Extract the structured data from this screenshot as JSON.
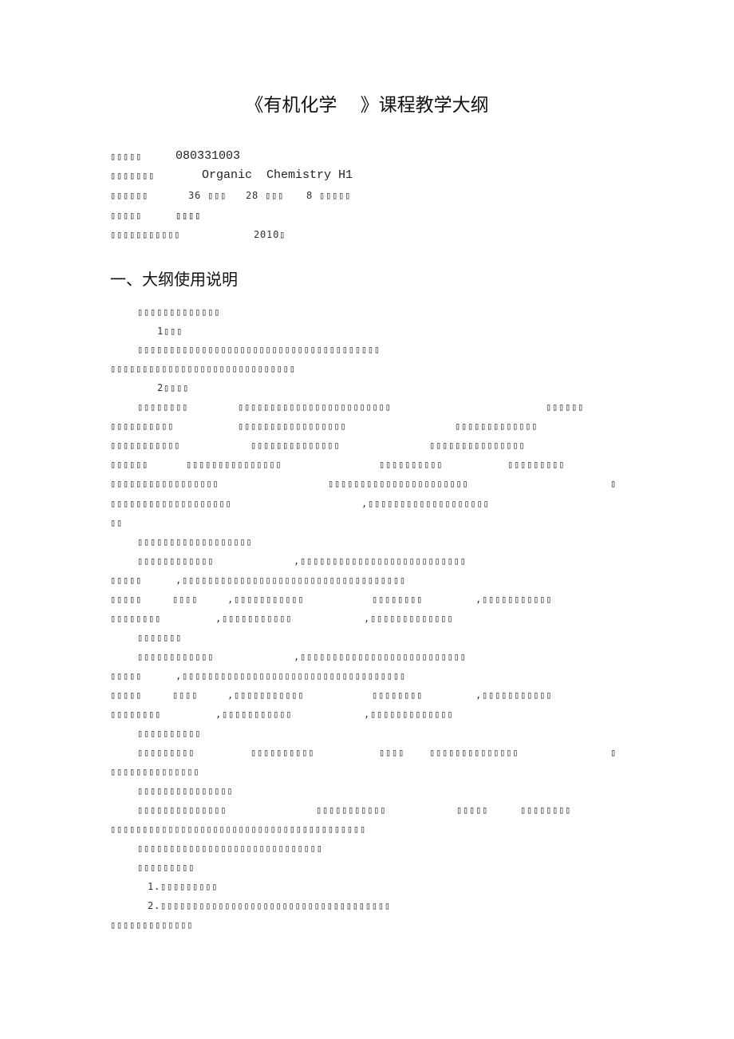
{
  "document": {
    "title": "《有机化学    》课程教学大纲",
    "info_lines": [
      [
        "▯▯▯▯▯",
        "080331003"
      ],
      [
        "▯▯▯▯▯▯▯",
        "Organic  Chemistry H1"
      ],
      [
        "▯▯▯▯▯▯",
        "36 ▯▯▯",
        "28 ▯▯▯",
        "8 ▯▯▯▯▯"
      ],
      [
        "▯▯▯▯▯",
        "▯▯▯▯"
      ],
      [
        "▯▯▯▯▯▯▯▯▯▯▯",
        "2010▯"
      ]
    ],
    "section_heading": "一、大纲使用说明",
    "body_lines": [
      [
        "▯▯▯▯▯▯▯▯▯▯▯▯▯"
      ],
      [
        "1▯▯▯"
      ],
      [
        "▯▯▯▯▯▯▯▯▯▯▯▯▯▯▯▯▯▯▯▯▯▯▯▯▯▯▯▯▯▯▯▯▯▯▯▯▯▯"
      ],
      [
        "▯▯▯▯▯▯▯▯▯▯▯▯▯▯▯▯▯▯▯▯▯▯▯▯▯▯▯▯▯"
      ],
      [
        "2▯▯▯▯"
      ],
      [
        "▯▯▯▯▯▯▯▯",
        "▯▯▯▯▯▯▯▯▯▯▯▯▯▯▯▯▯▯▯▯▯▯▯▯",
        "▯▯▯▯▯▯"
      ],
      [
        "▯▯▯▯▯▯▯▯▯▯",
        "▯▯▯▯▯▯▯▯▯▯▯▯▯▯▯▯▯",
        "▯▯▯▯▯▯▯▯▯▯▯▯▯"
      ],
      [
        "▯▯▯▯▯▯▯▯▯▯▯",
        "▯▯▯▯▯▯▯▯▯▯▯▯▯▯",
        "▯▯▯▯▯▯▯▯▯▯▯▯▯▯▯"
      ],
      [
        "▯▯▯▯▯▯",
        "▯▯▯▯▯▯▯▯▯▯▯▯▯▯▯",
        "▯▯▯▯▯▯▯▯▯▯",
        "▯▯▯▯▯▯▯▯▯"
      ],
      [
        "▯▯▯▯▯▯▯▯▯▯▯▯▯▯▯▯▯",
        "▯▯▯▯▯▯▯▯▯▯▯▯▯▯▯▯▯▯▯▯▯▯",
        "▯"
      ],
      [
        "▯▯▯▯▯▯▯▯▯▯▯▯▯▯▯▯▯▯▯",
        ",▯▯▯▯▯▯▯▯▯▯▯▯▯▯▯▯▯▯▯"
      ],
      [
        "▯▯"
      ],
      [
        "▯▯▯▯▯▯▯▯▯▯▯▯▯▯▯▯▯▯"
      ],
      [
        "▯▯▯▯▯▯▯▯▯▯▯▯",
        ",▯▯▯▯▯▯▯▯▯▯▯▯▯▯▯▯▯▯▯▯▯▯▯▯▯▯"
      ],
      [
        "▯▯▯▯▯",
        ",▯▯▯▯▯▯▯▯▯▯▯▯▯▯▯▯▯▯▯▯▯▯▯▯▯▯▯▯▯▯▯▯▯▯▯"
      ],
      [
        "▯▯▯▯▯",
        "▯▯▯▯",
        ",▯▯▯▯▯▯▯▯▯▯▯",
        "▯▯▯▯▯▯▯▯",
        ",▯▯▯▯▯▯▯▯▯▯▯"
      ],
      [
        "▯▯▯▯▯▯▯▯",
        ",▯▯▯▯▯▯▯▯▯▯▯",
        ",▯▯▯▯▯▯▯▯▯▯▯▯▯"
      ],
      [
        "▯▯▯▯▯▯▯"
      ],
      [
        "▯▯▯▯▯▯▯▯▯▯▯▯",
        ",▯▯▯▯▯▯▯▯▯▯▯▯▯▯▯▯▯▯▯▯▯▯▯▯▯▯"
      ],
      [
        "▯▯▯▯▯",
        ",▯▯▯▯▯▯▯▯▯▯▯▯▯▯▯▯▯▯▯▯▯▯▯▯▯▯▯▯▯▯▯▯▯▯▯"
      ],
      [
        "▯▯▯▯▯",
        "▯▯▯▯",
        ",▯▯▯▯▯▯▯▯▯▯▯",
        "▯▯▯▯▯▯▯▯",
        ",▯▯▯▯▯▯▯▯▯▯▯"
      ],
      [
        "▯▯▯▯▯▯▯▯",
        ",▯▯▯▯▯▯▯▯▯▯▯",
        ",▯▯▯▯▯▯▯▯▯▯▯▯▯"
      ],
      [
        "▯▯▯▯▯▯▯▯▯▯"
      ],
      [
        "▯▯▯▯▯▯▯▯▯",
        "▯▯▯▯▯▯▯▯▯▯",
        "▯▯▯▯",
        "▯▯▯▯▯▯▯▯▯▯▯▯▯▯",
        "▯"
      ],
      [
        "▯▯▯▯▯▯▯▯▯▯▯▯▯▯"
      ],
      [
        "▯▯▯▯▯▯▯▯▯▯▯▯▯▯▯"
      ],
      [
        "▯▯▯▯▯▯▯▯▯▯▯▯▯▯",
        "▯▯▯▯▯▯▯▯▯▯▯",
        "▯▯▯▯▯",
        "▯▯▯▯▯▯▯▯"
      ],
      [
        "▯▯▯▯▯▯▯▯▯▯▯▯▯▯▯▯▯▯▯▯▯▯▯▯▯▯▯▯▯▯▯▯▯▯▯▯▯▯▯▯"
      ],
      [
        "▯▯▯▯▯▯▯▯▯▯▯▯▯▯▯▯▯▯▯▯▯▯▯▯▯▯▯▯▯"
      ],
      [
        "▯▯▯▯▯▯▯▯▯"
      ],
      [
        "1.▯▯▯▯▯▯▯▯▯"
      ],
      [
        "2.▯▯▯▯▯▯▯▯▯▯▯▯▯▯▯▯▯▯▯▯▯▯▯▯▯▯▯▯▯▯▯▯▯▯▯▯"
      ],
      [
        "▯▯▯▯▯▯▯▯▯▯▯▯▯"
      ]
    ]
  }
}
